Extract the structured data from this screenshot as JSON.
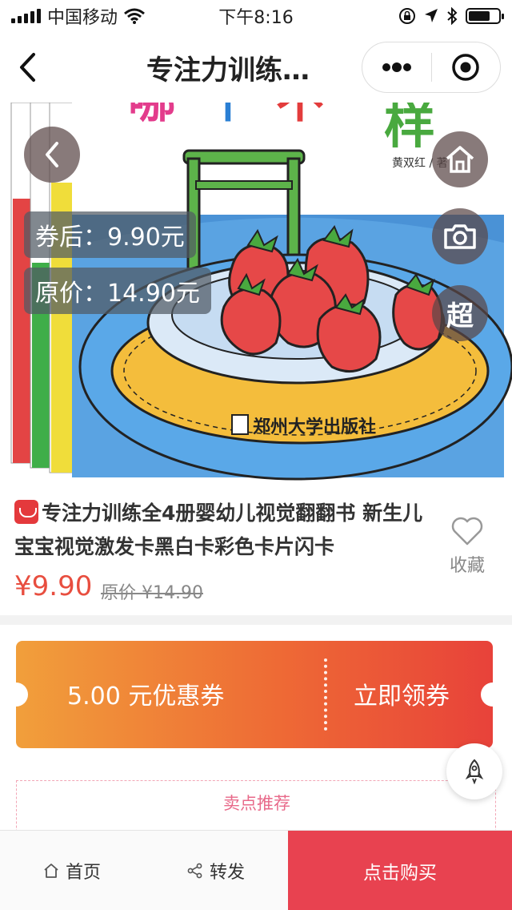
{
  "status_bar": {
    "carrier": "中国移动",
    "time": "下午8:16",
    "battery_level": 0.72
  },
  "nav": {
    "title": "专注力训练…",
    "back_icon": "chevron-left-icon",
    "more_icon": "more-dots-icon",
    "close_icon": "target-circle-icon"
  },
  "hero": {
    "coupon_price": "券后：9.90元",
    "original_price": "原价：14.90元",
    "super_label": "超",
    "book_title_chars": [
      "哪",
      "个",
      "不",
      "样"
    ],
    "author": "黄双红 / 著",
    "publisher": "郑州大学出版社",
    "icons": [
      "back-circle-icon",
      "home-icon",
      "camera-icon"
    ]
  },
  "product": {
    "title": "专注力训练全4册婴幼儿视觉翻翻书 新生儿宝宝视觉激发卡黑白卡彩色卡片闪卡",
    "price": "¥9.90",
    "original_price": "原价 ¥14.90",
    "favorite_label": "收藏"
  },
  "coupon": {
    "amount_text": "5.00 元优惠券",
    "action_label": "立即领券"
  },
  "selling_points": {
    "label": "卖点推荐"
  },
  "bottom_bar": {
    "home_label": "首页",
    "share_label": "转发",
    "buy_label": "点击购买"
  },
  "colors": {
    "accent_red": "#e84e3f",
    "buy_button": "#e84250",
    "coupon_gradient_start": "#f19f3b",
    "coupon_gradient_end": "#e8423a"
  }
}
